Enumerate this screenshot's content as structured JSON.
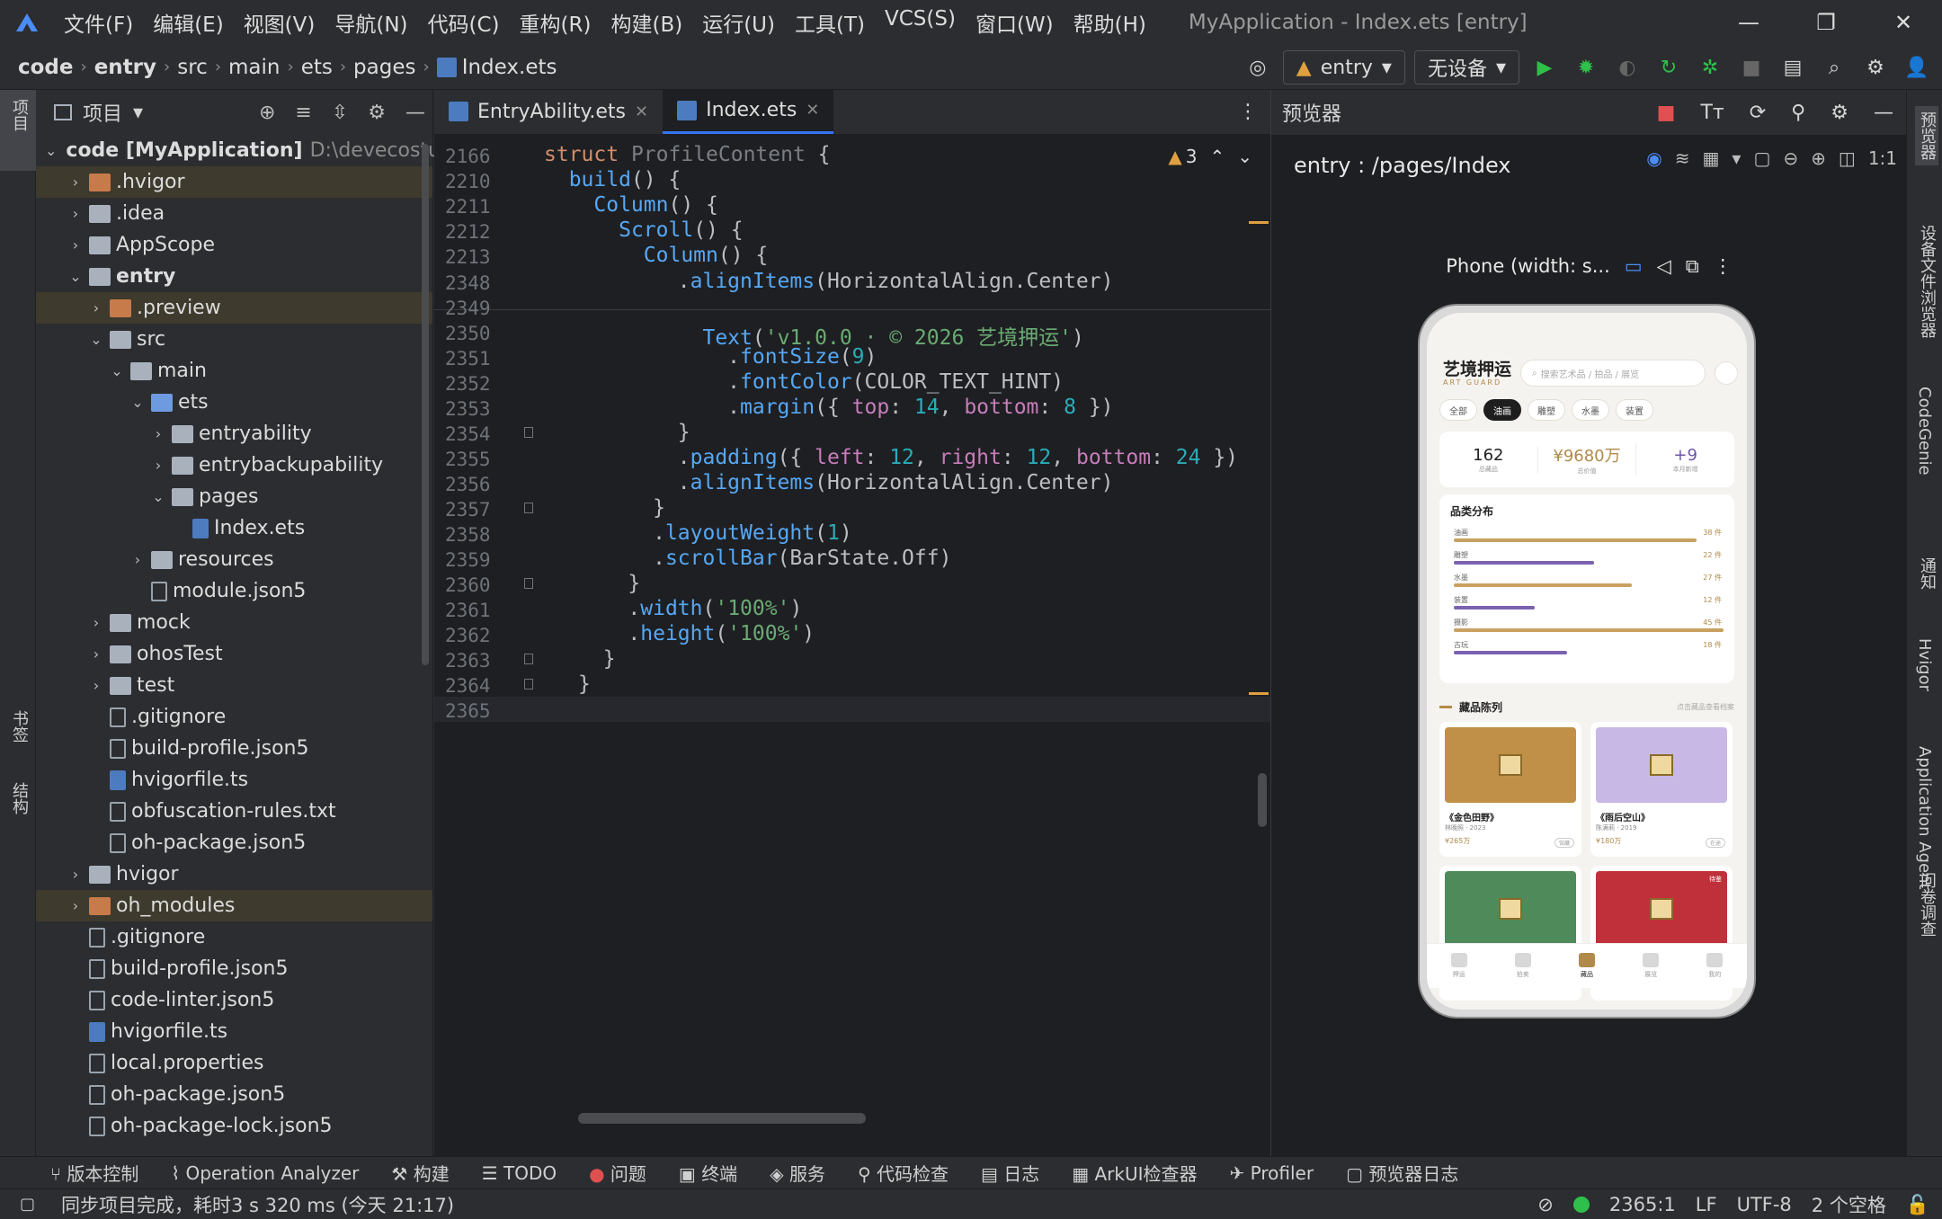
{
  "app": {
    "window_title": "MyApplication - Index.ets [entry]",
    "menu": [
      "文件(F)",
      "编辑(E)",
      "视图(V)",
      "导航(N)",
      "代码(C)",
      "重构(R)",
      "构建(B)",
      "运行(U)",
      "工具(T)",
      "VCS(S)",
      "窗口(W)",
      "帮助(H)"
    ],
    "window_controls": [
      "—",
      "❐",
      "✕"
    ]
  },
  "breadcrumb": [
    "code",
    "entry",
    "src",
    "main",
    "ets",
    "pages",
    "Index.ets"
  ],
  "toolbar": {
    "module": "entry",
    "device": "无设备"
  },
  "colors": {
    "accent": "#3574f0",
    "run_green": "#2fbf4a",
    "folder_orange": "#c77b4a",
    "gold": "#b08a4a"
  },
  "left_strip": {
    "project": "项目",
    "bookmarks": "书签",
    "structure": "结构"
  },
  "project": {
    "title": "项目",
    "tree": [
      {
        "depth": 0,
        "label": "code [MyApplication]",
        "extra": "D:\\devecostu",
        "arrow": "v",
        "icon": "folder"
      },
      {
        "depth": 1,
        "label": ".hvigor",
        "arrow": ">",
        "icon": "folder-orange"
      },
      {
        "depth": 1,
        "label": ".idea",
        "arrow": ">",
        "icon": "folder"
      },
      {
        "depth": 1,
        "label": "AppScope",
        "arrow": ">",
        "icon": "folder"
      },
      {
        "depth": 1,
        "label": "entry",
        "arrow": "v",
        "icon": "folder"
      },
      {
        "depth": 2,
        "label": ".preview",
        "arrow": ">",
        "icon": "folder-orange"
      },
      {
        "depth": 2,
        "label": "src",
        "arrow": "v",
        "icon": "folder"
      },
      {
        "depth": 3,
        "label": "main",
        "arrow": "v",
        "icon": "folder"
      },
      {
        "depth": 4,
        "label": "ets",
        "arrow": "v",
        "icon": "folder-blue"
      },
      {
        "depth": 5,
        "label": "entryability",
        "arrow": ">",
        "icon": "folder"
      },
      {
        "depth": 5,
        "label": "entrybackupability",
        "arrow": ">",
        "icon": "folder"
      },
      {
        "depth": 5,
        "label": "pages",
        "arrow": "v",
        "icon": "folder"
      },
      {
        "depth": 6,
        "label": "Index.ets",
        "arrow": "",
        "icon": "ts"
      },
      {
        "depth": 4,
        "label": "resources",
        "arrow": ">",
        "icon": "folder"
      },
      {
        "depth": 4,
        "label": "module.json5",
        "arrow": "",
        "icon": "file"
      },
      {
        "depth": 2,
        "label": "mock",
        "arrow": ">",
        "icon": "folder"
      },
      {
        "depth": 2,
        "label": "ohosTest",
        "arrow": ">",
        "icon": "folder"
      },
      {
        "depth": 2,
        "label": "test",
        "arrow": ">",
        "icon": "folder"
      },
      {
        "depth": 2,
        "label": ".gitignore",
        "arrow": "",
        "icon": "file"
      },
      {
        "depth": 2,
        "label": "build-profile.json5",
        "arrow": "",
        "icon": "file"
      },
      {
        "depth": 2,
        "label": "hvigorfile.ts",
        "arrow": "",
        "icon": "ts"
      },
      {
        "depth": 2,
        "label": "obfuscation-rules.txt",
        "arrow": "",
        "icon": "file"
      },
      {
        "depth": 2,
        "label": "oh-package.json5",
        "arrow": "",
        "icon": "file"
      },
      {
        "depth": 1,
        "label": "hvigor",
        "arrow": ">",
        "icon": "folder"
      },
      {
        "depth": 1,
        "label": "oh_modules",
        "arrow": ">",
        "icon": "folder-orange"
      },
      {
        "depth": 1,
        "label": ".gitignore",
        "arrow": "",
        "icon": "file"
      },
      {
        "depth": 1,
        "label": "build-profile.json5",
        "arrow": "",
        "icon": "file"
      },
      {
        "depth": 1,
        "label": "code-linter.json5",
        "arrow": "",
        "icon": "file"
      },
      {
        "depth": 1,
        "label": "hvigorfile.ts",
        "arrow": "",
        "icon": "ts"
      },
      {
        "depth": 1,
        "label": "local.properties",
        "arrow": "",
        "icon": "file"
      },
      {
        "depth": 1,
        "label": "oh-package.json5",
        "arrow": "",
        "icon": "file"
      },
      {
        "depth": 1,
        "label": "oh-package-lock.json5",
        "arrow": "",
        "icon": "file"
      }
    ]
  },
  "editor": {
    "tabs": [
      {
        "label": "EntryAbility.ets",
        "active": false
      },
      {
        "label": "Index.ets",
        "active": true
      }
    ],
    "warnings": "3",
    "sticky": [
      {
        "ln": "2166",
        "code": "struct ProfileContent {"
      },
      {
        "ln": "2210",
        "code": "  build() {"
      },
      {
        "ln": "2211",
        "code": "    Column() {"
      },
      {
        "ln": "2212",
        "code": "      Scroll() {"
      },
      {
        "ln": "2213",
        "code": "        Column() {"
      }
    ],
    "lines": [
      {
        "ln": "2348",
        "code": "        .alignItems(HorizontalAlign.Center)"
      },
      {
        "ln": "2349",
        "code": ""
      },
      {
        "ln": "2350",
        "code": "          Text('v1.0.0 · © 2026 艺境押运')"
      },
      {
        "ln": "2351",
        "code": "            .fontSize(9)"
      },
      {
        "ln": "2352",
        "code": "            .fontColor(COLOR_TEXT_HINT)"
      },
      {
        "ln": "2353",
        "code": "            .margin({ top: 14, bottom: 8 })"
      },
      {
        "ln": "2354",
        "code": "        }"
      },
      {
        "ln": "2355",
        "code": "        .padding({ left: 12, right: 12, bottom: 24 })"
      },
      {
        "ln": "2356",
        "code": "        .alignItems(HorizontalAlign.Center)"
      },
      {
        "ln": "2357",
        "code": "      }"
      },
      {
        "ln": "2358",
        "code": "      .layoutWeight(1)"
      },
      {
        "ln": "2359",
        "code": "      .scrollBar(BarState.Off)"
      },
      {
        "ln": "2360",
        "code": "    }"
      },
      {
        "ln": "2361",
        "code": "    .width('100%')"
      },
      {
        "ln": "2362",
        "code": "    .height('100%')"
      },
      {
        "ln": "2363",
        "code": "  }"
      },
      {
        "ln": "2364",
        "code": "}"
      },
      {
        "ln": "2365",
        "code": ""
      }
    ]
  },
  "preview": {
    "title": "预览器",
    "route": "entry : /pages/Index",
    "device_label": "Phone (width: s...",
    "phone": {
      "brand": "艺境押运",
      "brand_sub": "ART GUARD",
      "search_placeholder": "搜索艺术品 / 拍品 / 展览",
      "chips": [
        "全部",
        "油画",
        "雕塑",
        "水墨",
        "装置"
      ],
      "active_chip": 1,
      "stats": [
        {
          "value": "162",
          "label": "总藏品"
        },
        {
          "value": "¥9680万",
          "label": "总价值"
        },
        {
          "value": "+9",
          "label": "本月新增"
        }
      ],
      "dist_title": "品类分布",
      "categories": [
        {
          "name": "油画",
          "count": "38 件",
          "fraction": 0.9,
          "color": "#c8a060"
        },
        {
          "name": "雕塑",
          "count": "22 件",
          "fraction": 0.52,
          "color": "#7a62b0"
        },
        {
          "name": "水墨",
          "count": "27 件",
          "fraction": 0.66,
          "color": "#c8a060"
        },
        {
          "name": "装置",
          "count": "12 件",
          "fraction": 0.3,
          "color": "#7a62b0"
        },
        {
          "name": "摄影",
          "count": "45 件",
          "fraction": 1.0,
          "color": "#c8a060"
        },
        {
          "name": "古玩",
          "count": "18 件",
          "fraction": 0.42,
          "color": "#7a62b0"
        }
      ],
      "gallery_title": "藏品陈列",
      "gallery_more": "点击藏品查看档案",
      "artworks": [
        {
          "name": "《金色田野》",
          "meta": "林晚照 · 2023",
          "price": "¥265万",
          "badge": "馆藏",
          "color": "#c09048"
        },
        {
          "name": "《雨后空山》",
          "meta": "陈满莉 · 2019",
          "price": "¥180万",
          "badge": "在途",
          "color": "#c8b8e6"
        },
        {
          "name": "",
          "meta": "",
          "price": "",
          "badge": "",
          "color": "#4f8a5a"
        },
        {
          "name": "",
          "meta": "",
          "price": "",
          "badge": "",
          "color": "#c0303a",
          "tag": "待鉴"
        }
      ],
      "tabs": [
        "押运",
        "拍卖",
        "藏品",
        "展览",
        "我的"
      ],
      "active_tab": 2
    }
  },
  "right_strip": [
    "预览器",
    "设备文件浏览器",
    "CodeGenie",
    "通知",
    "Hvigor",
    "Application Agent",
    "问卷调查"
  ],
  "bottom_tools": [
    "版本控制",
    "Operation Analyzer",
    "构建",
    "TODO",
    "问题",
    "终端",
    "服务",
    "代码检查",
    "日志",
    "ArkUI检查器",
    "Profiler",
    "预览器日志"
  ],
  "status": {
    "message": "同步项目完成，耗时3 s 320 ms (今天 21:17)",
    "position": "2365:1",
    "line_sep": "LF",
    "encoding": "UTF-8",
    "indent": "2 个空格"
  }
}
